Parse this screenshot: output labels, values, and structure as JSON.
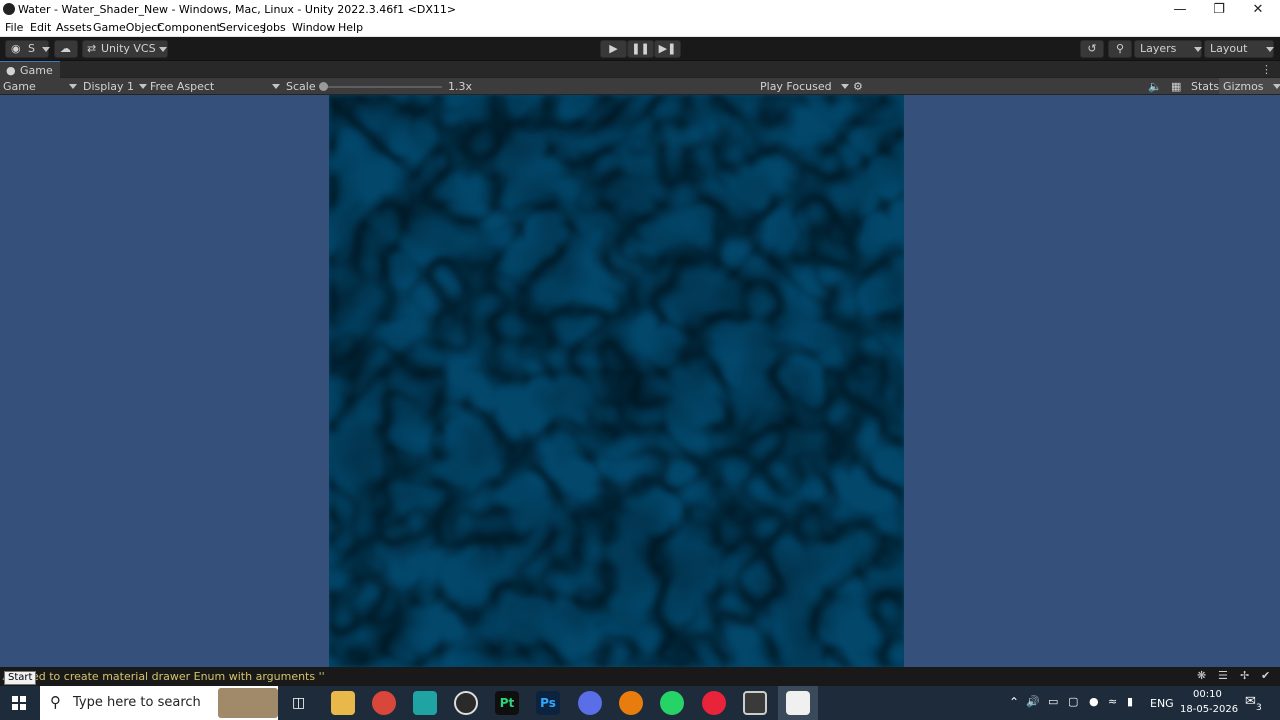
{
  "window": {
    "title": "Water - Water_Shader_New - Windows, Mac, Linux - Unity 2022.3.46f1 <DX11>",
    "minimize": "—",
    "maximize": "❐",
    "close": "✕"
  },
  "menu": [
    "File",
    "Edit",
    "Assets",
    "GameObject",
    "Component",
    "Services",
    "Jobs",
    "Window",
    "Help"
  ],
  "toolbar": {
    "account_label": "S",
    "vcs_label": "Unity VCS",
    "layers_label": "Layers",
    "layout_label": "Layout"
  },
  "game_tab": {
    "label": "Game"
  },
  "game_controls": {
    "view_label": "Game",
    "display_label": "Display 1",
    "aspect_label": "Free Aspect",
    "scale_label": "Scale",
    "scale_value": "1.3x",
    "scale_fraction": 0.02,
    "play_mode_label": "Play Focused",
    "stats_label": "Stats",
    "gizmos_label": "Gizmos"
  },
  "status": {
    "message": "ed to create material drawer Enum with arguments ''",
    "tooltip": "Start"
  },
  "taskbar": {
    "search_placeholder": "Type here to search",
    "language": "ENG",
    "time": "00:10",
    "date": "18-05-2026",
    "notification_count": "3"
  },
  "colors": {
    "viewport_background": "#34507b",
    "water_dark": "#03476b",
    "water_light": "#3fa3c4",
    "status_text": "#d4c36a",
    "taskbar": "#1d2b3a"
  }
}
